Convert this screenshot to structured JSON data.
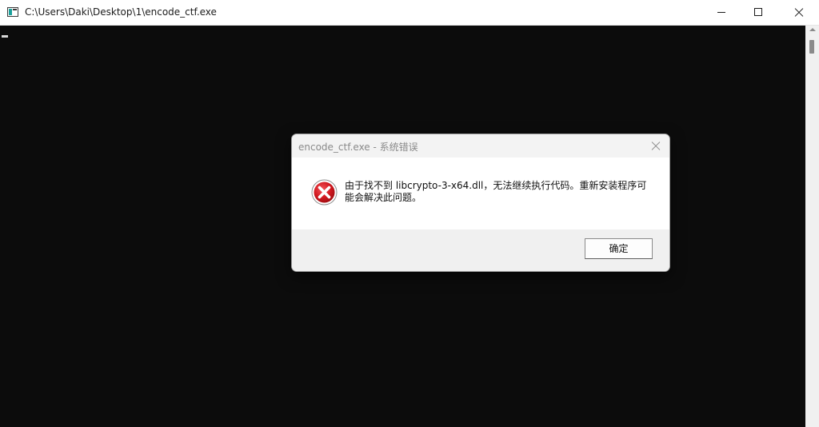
{
  "window": {
    "title": "C:\\Users\\Daki\\Desktop\\1\\encode_ctf.exe",
    "icon": "console-app-icon",
    "caption_buttons": [
      "minimize-icon",
      "maximize-icon",
      "close-icon"
    ]
  },
  "console": {
    "background": "#0c0c0c",
    "cursor_color": "#d8d8d8"
  },
  "dialog": {
    "title": "encode_ctf.exe - 系统错误",
    "icon": "error-icon",
    "message": "由于找不到 libcrypto-3-x64.dll，无法继续执行代码。重新安装程序可能会解决此问题。",
    "ok_label": "确定",
    "error_color": "#d0161d"
  }
}
